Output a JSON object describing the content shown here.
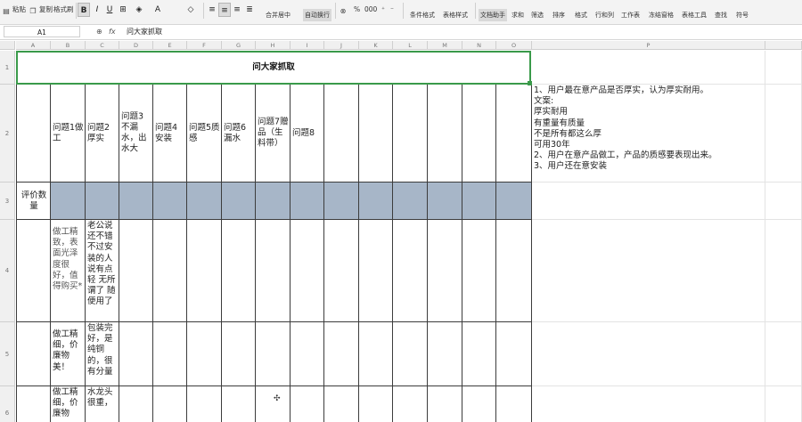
{
  "ribbon": {
    "paste": "粘贴",
    "cut": "剪切",
    "copy": "复制",
    "format_painter": "格式刷",
    "bold": "B",
    "italic": "I",
    "underline": "U",
    "align_left": "≡",
    "align_center": "≡",
    "align_right": "≡",
    "merge_center": "合并居中",
    "wrap_text": "自动换行",
    "percent": "%",
    "thousands": "000",
    "conditional_format": "条件格式",
    "table_style": "表格样式",
    "doc_assistant": "文档助手",
    "sum": "求和",
    "filter": "筛选",
    "sort": "排序",
    "format": "格式",
    "row_col": "行和列",
    "worksheet": "工作表",
    "freeze": "冻结窗格",
    "table_tools": "表格工具",
    "find": "查找",
    "symbol": "符号"
  },
  "formula_bar": {
    "cell_ref": "A1",
    "fx": "fx",
    "content": "问大家抓取"
  },
  "columns": [
    "A",
    "B",
    "C",
    "D",
    "E",
    "F",
    "G",
    "H",
    "I",
    "J",
    "K",
    "L",
    "M",
    "N",
    "O",
    "P"
  ],
  "rows": [
    "1",
    "2",
    "3",
    "4",
    "5",
    "6"
  ],
  "sheet": {
    "title": "问大家抓取",
    "row3_label": "评价数量",
    "questions": [
      "问题1做工",
      "问题2厚实",
      "问题3不漏水，出水大",
      "问题4安装",
      "问题5质感",
      "问题6漏水",
      "问题7赠品（生料带）",
      "问题8"
    ],
    "row4": {
      "b": "做工精致，表面光泽度很好，值得购买*",
      "c": "老公说还不错不过安装的人说有点轻 无所谓了 随便用了"
    },
    "row5": {
      "b": "做工精细，价廉物美！",
      "c": "包装完好，是纯铜的，很有分量"
    },
    "row6": {
      "b": "做工精细，价廉物",
      "c": "水龙头很重，"
    },
    "notes": [
      "1、用户最在意产品是否厚实，认为厚实耐用。",
      "文案:",
      "厚实耐用",
      "有重量有质量",
      "不是所有都这么厚",
      "可用30年",
      "2、用户在意产品做工，产品的质感要表现出来。",
      "3、用户还在意安装"
    ]
  }
}
